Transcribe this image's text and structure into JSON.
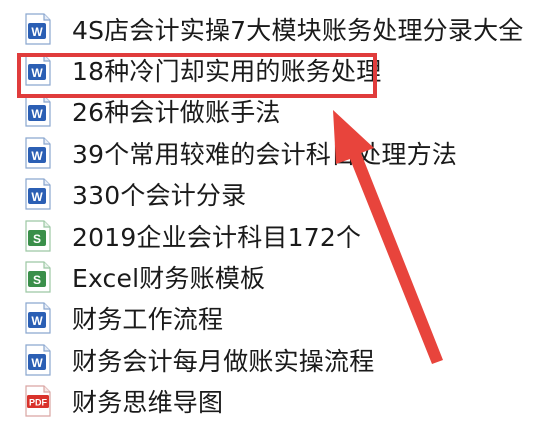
{
  "files": [
    {
      "name": "4S店会计实操7大模块账务处理分录大全",
      "icon": "word-doc-icon"
    },
    {
      "name": "18种冷门却实用的账务处理",
      "icon": "word-doc-icon"
    },
    {
      "name": "26种会计做账手法",
      "icon": "word-doc-icon"
    },
    {
      "name": "39个常用较难的会计科目处理方法",
      "icon": "word-doc-icon"
    },
    {
      "name": "330个会计分录",
      "icon": "word-doc-icon"
    },
    {
      "name": "2019企业会计科目172个",
      "icon": "excel-sheet-icon"
    },
    {
      "name": "Excel财务账模板",
      "icon": "excel-sheet-icon"
    },
    {
      "name": "财务工作流程",
      "icon": "word-doc-icon"
    },
    {
      "name": "财务会计每月做账实操流程",
      "icon": "word-doc-icon"
    },
    {
      "name": "财务思维导图",
      "icon": "pdf-doc-icon"
    }
  ],
  "highlighted_index": 1,
  "colors": {
    "word": "#2b5fb4",
    "excel": "#3a8f4a",
    "pdf": "#d9322b",
    "highlight": "#e03c3c"
  }
}
